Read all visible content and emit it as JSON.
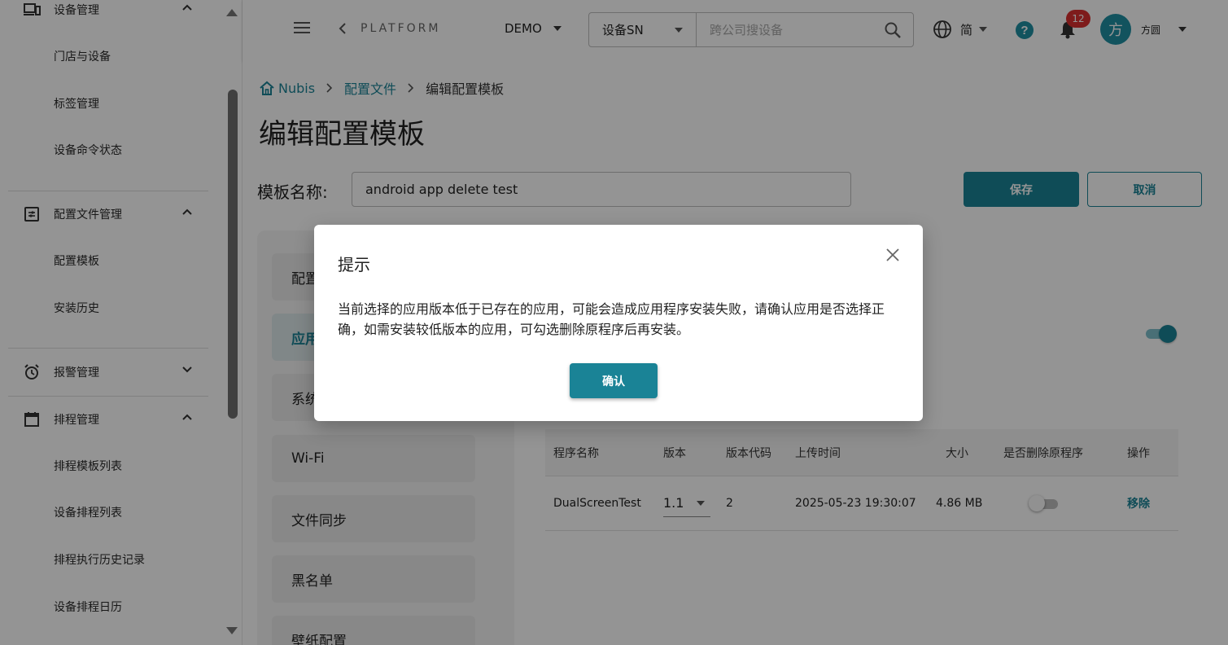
{
  "colors": {
    "accent": "#1a8396",
    "badge": "#d93030",
    "avatar": "#1f8fa3"
  },
  "sidebar": {
    "groups": [
      {
        "label": "设备管理",
        "icon": "devices-icon",
        "expanded": true,
        "children": [
          "门店与设备",
          "标签管理",
          "设备命令状态"
        ]
      },
      {
        "label": "配置文件管理",
        "icon": "config-file-icon",
        "expanded": true,
        "children": [
          "配置模板",
          "安装历史"
        ]
      },
      {
        "label": "报警管理",
        "icon": "alarm-clock-icon",
        "expanded": false,
        "children": []
      },
      {
        "label": "排程管理",
        "icon": "calendar-icon",
        "expanded": true,
        "children": [
          "排程模板列表",
          "设备排程列表",
          "排程执行历史记录",
          "设备排程日历"
        ]
      }
    ]
  },
  "header": {
    "platform": "PLATFORM",
    "org": "DEMO",
    "search_type": "设备SN",
    "search_placeholder": "跨公司搜设备",
    "language": "简",
    "notification_count": "12",
    "avatar_initial": "方",
    "username": "方圆"
  },
  "breadcrumb": {
    "root": "Nubis",
    "parent": "配置文件",
    "current": "编辑配置模板"
  },
  "page": {
    "title": "编辑配置模板",
    "template_label": "模板名称:",
    "template_name": "android app delete test",
    "save_label": "保存",
    "cancel_label": "取消"
  },
  "tabs": [
    "配置",
    "应用",
    "系统",
    "Wi-Fi",
    "文件同步",
    "黑名单",
    "壁纸配置"
  ],
  "table": {
    "columns": [
      "程序名称",
      "版本",
      "版本代码",
      "上传时间",
      "大小",
      "是否删除原程序",
      "操作"
    ],
    "rows": [
      {
        "name": "DualScreenTest",
        "version": "1.1",
        "version_code": "2",
        "upload_time": "2025-05-23 19:30:07",
        "size": "4.86 MB",
        "delete_original": false,
        "action": "移除"
      }
    ]
  },
  "dialog": {
    "title": "提示",
    "message": "当前选择的应用版本低于已存在的应用，可能会造成应用程序安装失败，请确认应用是否选择正确，如需安装较低版本的应用，可勾选删除原程序后再安装。",
    "confirm_label": "确认"
  }
}
